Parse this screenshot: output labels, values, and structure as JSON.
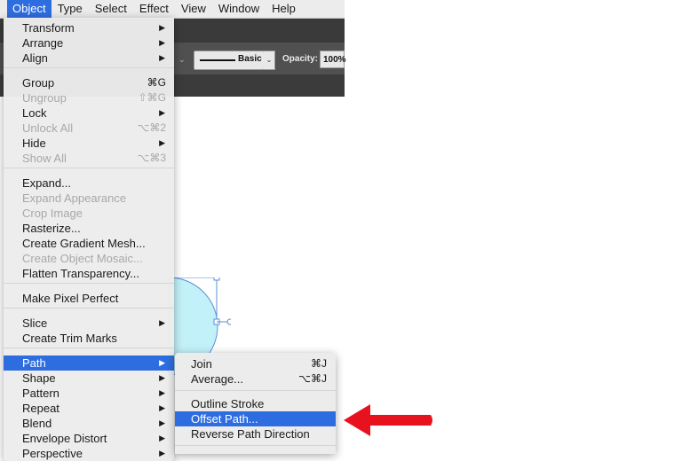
{
  "menubar": {
    "items": [
      "Object",
      "Type",
      "Select",
      "Effect",
      "View",
      "Window",
      "Help"
    ]
  },
  "toolbar": {
    "stroke_style_label": "Basic",
    "opacity_label": "Opacity:",
    "opacity_value": "100%"
  },
  "object_menu": {
    "items": [
      {
        "label": "Transform",
        "shortcut": "",
        "submenu": true,
        "disabled": false
      },
      {
        "label": "Arrange",
        "shortcut": "",
        "submenu": true,
        "disabled": false
      },
      {
        "label": "Align",
        "shortcut": "",
        "submenu": true,
        "disabled": false
      },
      {
        "label": "Group",
        "shortcut": "⌘G",
        "submenu": false,
        "disabled": false
      },
      {
        "label": "Ungroup",
        "shortcut": "⇧⌘G",
        "submenu": false,
        "disabled": true
      },
      {
        "label": "Lock",
        "shortcut": "",
        "submenu": true,
        "disabled": false
      },
      {
        "label": "Unlock All",
        "shortcut": "⌥⌘2",
        "submenu": false,
        "disabled": true
      },
      {
        "label": "Hide",
        "shortcut": "",
        "submenu": true,
        "disabled": false
      },
      {
        "label": "Show All",
        "shortcut": "⌥⌘3",
        "submenu": false,
        "disabled": true
      },
      {
        "label": "Expand...",
        "shortcut": "",
        "submenu": false,
        "disabled": false
      },
      {
        "label": "Expand Appearance",
        "shortcut": "",
        "submenu": false,
        "disabled": true
      },
      {
        "label": "Crop Image",
        "shortcut": "",
        "submenu": false,
        "disabled": true
      },
      {
        "label": "Rasterize...",
        "shortcut": "",
        "submenu": false,
        "disabled": false
      },
      {
        "label": "Create Gradient Mesh...",
        "shortcut": "",
        "submenu": false,
        "disabled": false
      },
      {
        "label": "Create Object Mosaic...",
        "shortcut": "",
        "submenu": false,
        "disabled": true
      },
      {
        "label": "Flatten Transparency...",
        "shortcut": "",
        "submenu": false,
        "disabled": false
      },
      {
        "label": "Make Pixel Perfect",
        "shortcut": "",
        "submenu": false,
        "disabled": false
      },
      {
        "label": "Slice",
        "shortcut": "",
        "submenu": true,
        "disabled": false
      },
      {
        "label": "Create Trim Marks",
        "shortcut": "",
        "submenu": false,
        "disabled": false
      },
      {
        "label": "Path",
        "shortcut": "",
        "submenu": true,
        "disabled": false
      },
      {
        "label": "Shape",
        "shortcut": "",
        "submenu": true,
        "disabled": false
      },
      {
        "label": "Pattern",
        "shortcut": "",
        "submenu": true,
        "disabled": false
      },
      {
        "label": "Repeat",
        "shortcut": "",
        "submenu": true,
        "disabled": false
      },
      {
        "label": "Blend",
        "shortcut": "",
        "submenu": true,
        "disabled": false
      },
      {
        "label": "Envelope Distort",
        "shortcut": "",
        "submenu": true,
        "disabled": false
      },
      {
        "label": "Perspective",
        "shortcut": "",
        "submenu": true,
        "disabled": false
      }
    ]
  },
  "path_submenu": {
    "items": [
      {
        "label": "Join",
        "shortcut": "⌘J"
      },
      {
        "label": "Average...",
        "shortcut": "⌥⌘J"
      },
      {
        "label": "Outline Stroke",
        "shortcut": ""
      },
      {
        "label": "Offset Path...",
        "shortcut": ""
      },
      {
        "label": "Reverse Path Direction",
        "shortcut": ""
      }
    ]
  },
  "colors": {
    "selection_blue": "#2e6de0",
    "annotation_red": "#e8121f",
    "circle_fill": "#c3f1f9",
    "handle_blue": "#5a8fd8"
  }
}
